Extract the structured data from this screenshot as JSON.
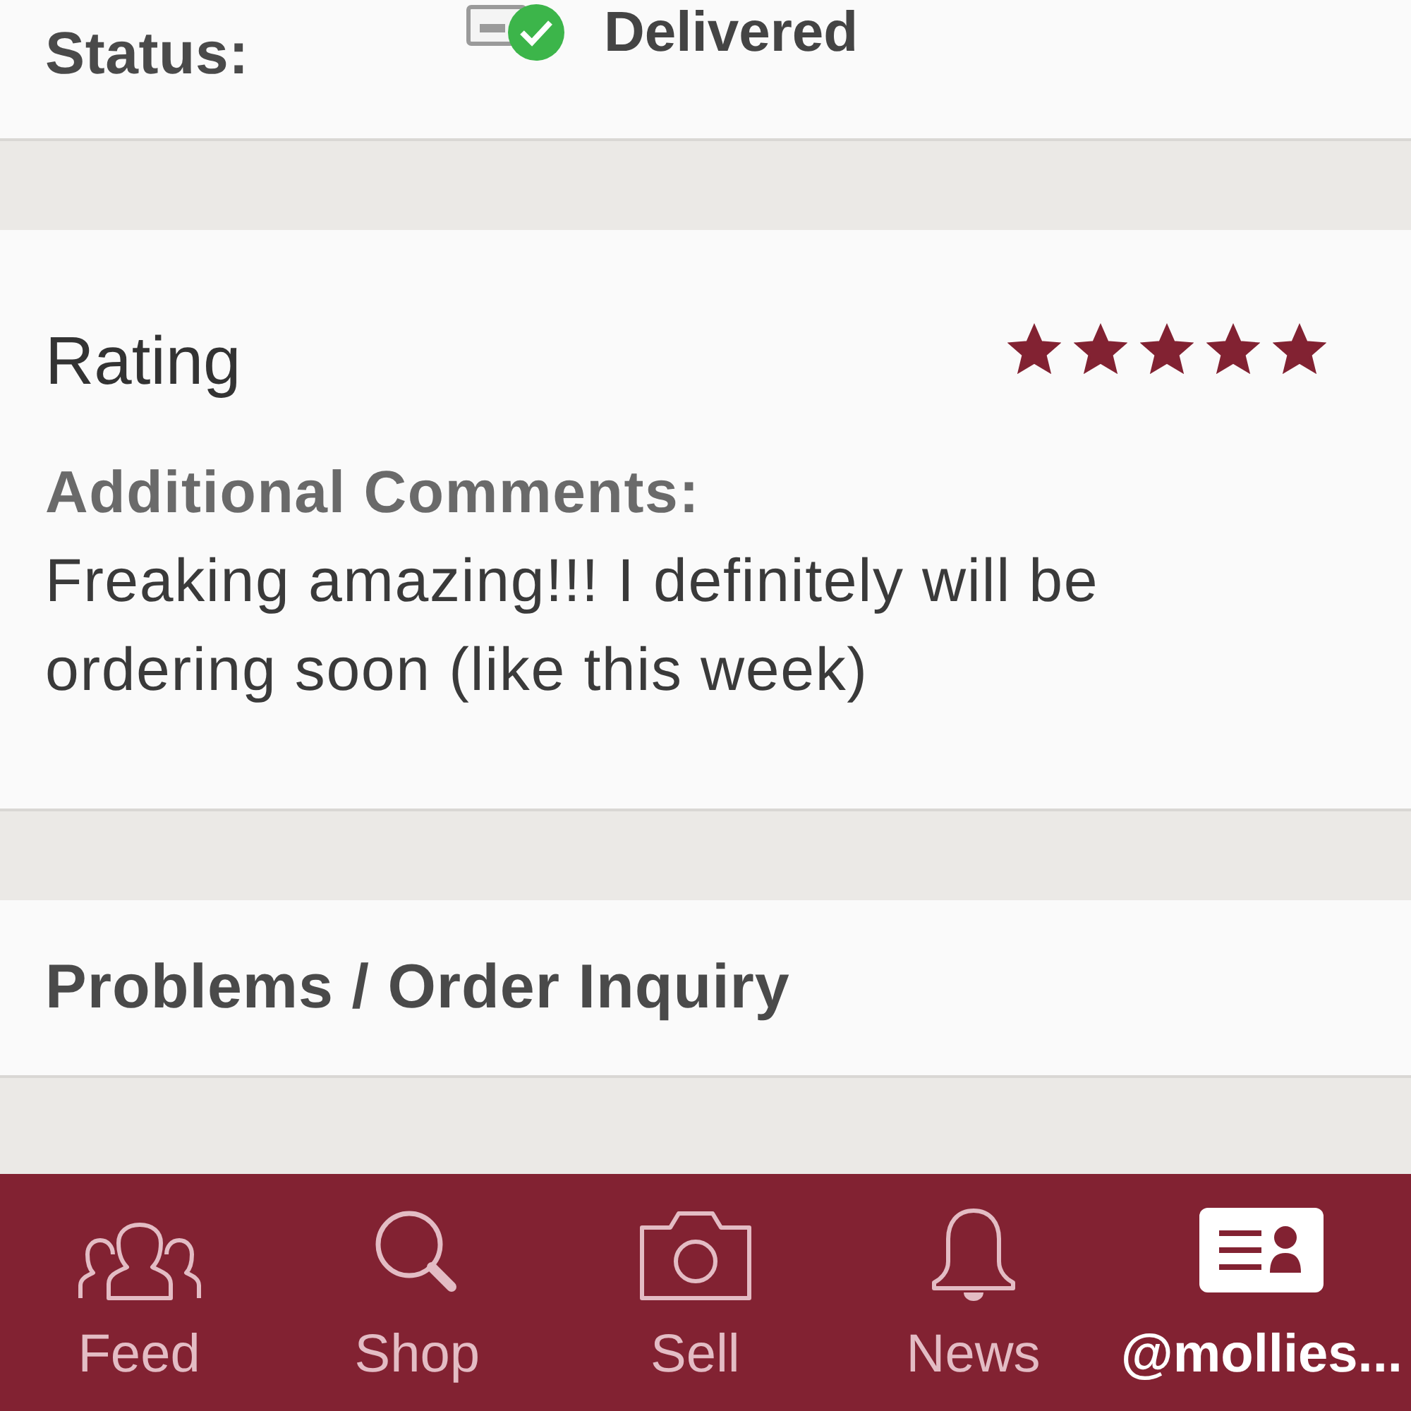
{
  "order_status": {
    "label": "Status:",
    "value": "Delivered"
  },
  "review": {
    "title": "Rating",
    "stars": 5,
    "comments_label": "Additional Comments:",
    "comments": "Freaking amazing!!! I definitely will be ordering soon (like this week)"
  },
  "problems_link": {
    "label": "Problems / Order Inquiry"
  },
  "tab_bar": [
    {
      "label": "Feed",
      "selected": false
    },
    {
      "label": "Shop",
      "selected": false
    },
    {
      "label": "Sell",
      "selected": false
    },
    {
      "label": "News",
      "selected": false
    },
    {
      "label": "@mollies...",
      "selected": true
    }
  ]
}
